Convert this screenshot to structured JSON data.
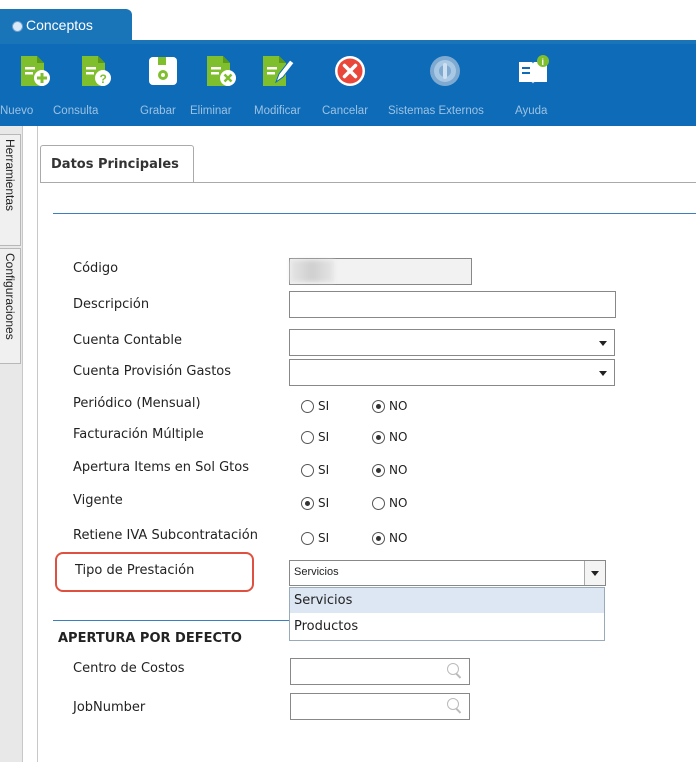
{
  "window": {
    "tab_title": "Conceptos"
  },
  "toolbar": {
    "buttons": [
      {
        "label": "Nuevo",
        "icon": "doc-add-icon",
        "active": false
      },
      {
        "label": "Consulta",
        "icon": "doc-query-icon",
        "active": false
      },
      {
        "label": "Grabar",
        "icon": "save-icon",
        "active": true
      },
      {
        "label": "Eliminar",
        "icon": "doc-delete-icon",
        "active": false
      },
      {
        "label": "Modificar",
        "icon": "doc-edit-icon",
        "active": false
      },
      {
        "label": "Cancelar",
        "icon": "cancel-icon",
        "active": true
      },
      {
        "label": "Sistemas Externos",
        "icon": "external-systems-icon",
        "active": false
      },
      {
        "label": "Ayuda",
        "icon": "help-book-icon",
        "active": true
      }
    ]
  },
  "side_tabs": [
    "Herramientas",
    "Configuraciones"
  ],
  "section_tab": "Datos Principales",
  "form": {
    "codigo_label": "Código",
    "descripcion_label": "Descripción",
    "cuenta_contable_label": "Cuenta Contable",
    "cuenta_provision_label": "Cuenta Provisión Gastos",
    "radio_rows": [
      {
        "label": "Periódico (Mensual)",
        "si": "SI",
        "no": "NO",
        "value": "NO"
      },
      {
        "label": "Facturación Múltiple",
        "si": "SI",
        "no": "NO",
        "value": "NO"
      },
      {
        "label": "Apertura Items en Sol Gtos",
        "si": "SI",
        "no": "NO",
        "value": "NO"
      },
      {
        "label": "Vigente",
        "si": "SI",
        "no": "NO",
        "value": "SI"
      },
      {
        "label": "Retiene IVA Subcontratación",
        "si": "SI",
        "no": "NO",
        "value": "NO"
      }
    ],
    "tipo_prestacion_label": "Tipo de Prestación",
    "tipo_prestacion_value": "Servicios",
    "tipo_prestacion_options": [
      "Servicios",
      "Productos"
    ]
  },
  "apertura": {
    "title": "APERTURA POR DEFECTO",
    "centro_label": "Centro de Costos",
    "jobnumber_label": "JobNumber"
  },
  "colors": {
    "toolbar_bg": "#0d6bb8",
    "highlight": "#e05040"
  }
}
